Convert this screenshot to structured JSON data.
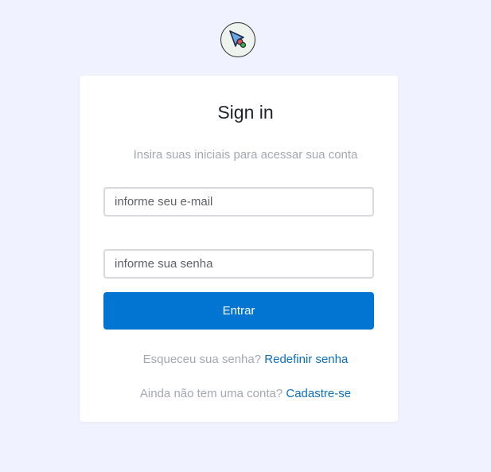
{
  "logo": {
    "icon": "cursor-pointer-icon"
  },
  "signin": {
    "title": "Sign in",
    "subtitle": "Insira suas iniciais para acessar sua conta",
    "email_placeholder": "informe seu e-mail",
    "password_placeholder": "informe sua senha",
    "submit_label": "Entrar",
    "forgot_text": "Esqueceu sua senha?",
    "forgot_link": "Redefinir senha",
    "signup_text": "Ainda não tem uma conta?",
    "signup_link": "Cadastre-se"
  },
  "colors": {
    "background": "#f0f2ff",
    "primary": "#0175d1",
    "link": "#0d6ebd",
    "muted_text": "#a3a7b0"
  }
}
